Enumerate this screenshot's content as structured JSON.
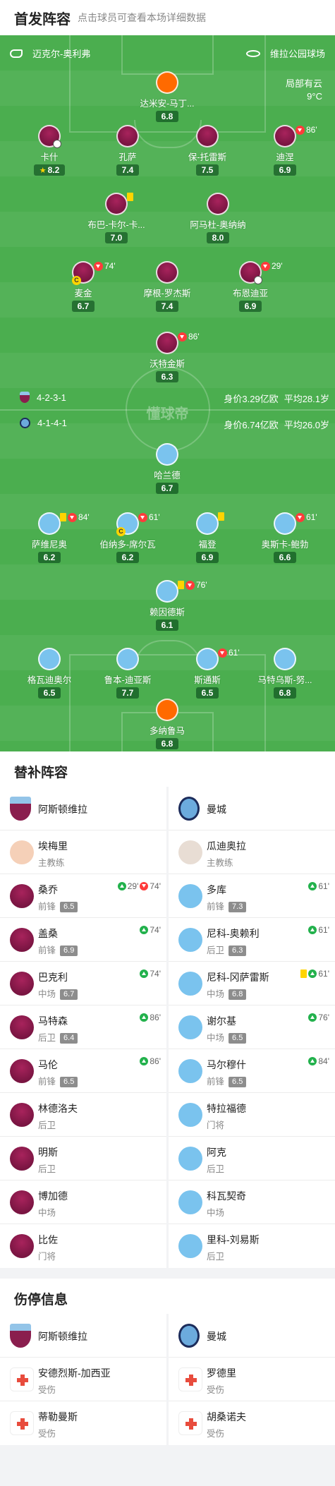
{
  "header": {
    "title": "首发阵容",
    "subtitle": "点击球员可查看本场详细数据"
  },
  "pitch": {
    "home_coach_label": "迈克尔-奥利弗",
    "venue": "维拉公园球场",
    "weather": "局部有云",
    "temp": "9°C",
    "watermark": "懂球帝",
    "home": {
      "formation": "4-2-3-1",
      "value": "身价3.29亿欧",
      "avg_age": "平均28.1岁"
    },
    "away": {
      "formation": "4-1-4-1",
      "value": "身价6.74亿欧",
      "avg_age": "平均26.0岁"
    }
  },
  "players": [
    {
      "name": "达米安-马丁...",
      "rating": "6.8"
    },
    {
      "name": "卡什",
      "rating": "8.2"
    },
    {
      "name": "孔萨",
      "rating": "7.4"
    },
    {
      "name": "保-托雷斯",
      "rating": "7.5"
    },
    {
      "name": "迪涅",
      "rating": "6.9",
      "ev": "86'"
    },
    {
      "name": "布巴-卡尔-卡...",
      "rating": "7.0"
    },
    {
      "name": "阿马杜-奥纳纳",
      "rating": "8.0"
    },
    {
      "name": "麦金",
      "rating": "6.7",
      "ev": "74'"
    },
    {
      "name": "摩根-罗杰斯",
      "rating": "7.4"
    },
    {
      "name": "布恩迪亚",
      "rating": "6.9",
      "ev": "29'"
    },
    {
      "name": "沃特金斯",
      "rating": "6.3",
      "ev": "86'"
    },
    {
      "name": "哈兰德",
      "rating": "6.7"
    },
    {
      "name": "萨维尼奥",
      "rating": "6.2",
      "ev": "84'"
    },
    {
      "name": "伯纳多-席尔瓦",
      "rating": "6.2",
      "ev": "61'"
    },
    {
      "name": "福登",
      "rating": "6.9"
    },
    {
      "name": "奥斯卡-鲍勃",
      "rating": "6.6",
      "ev": "61'"
    },
    {
      "name": "赖因德斯",
      "rating": "6.1",
      "ev": "76'"
    },
    {
      "name": "格瓦迪奥尔",
      "rating": "6.5"
    },
    {
      "name": "鲁本-迪亚斯",
      "rating": "7.7"
    },
    {
      "name": "斯通斯",
      "rating": "6.5",
      "ev": "61'"
    },
    {
      "name": "马特乌斯-努...",
      "rating": "6.8"
    },
    {
      "name": "多纳鲁马",
      "rating": "6.8"
    }
  ],
  "subs": {
    "title": "替补阵容",
    "home": {
      "team": "阿斯顿维拉",
      "coach": "埃梅里",
      "coach_role": "主教练",
      "list": [
        {
          "name": "桑乔",
          "pos": "前锋",
          "rating": "6.5",
          "in": "29'",
          "out": "74'"
        },
        {
          "name": "盖桑",
          "pos": "前锋",
          "rating": "6.9",
          "in": "74'"
        },
        {
          "name": "巴克利",
          "pos": "中场",
          "rating": "6.7",
          "in": "74'"
        },
        {
          "name": "马特森",
          "pos": "后卫",
          "rating": "6.4",
          "in": "86'"
        },
        {
          "name": "马伦",
          "pos": "前锋",
          "rating": "6.5",
          "in": "86'"
        },
        {
          "name": "林德洛夫",
          "pos": "后卫"
        },
        {
          "name": "明斯",
          "pos": "后卫"
        },
        {
          "name": "博加德",
          "pos": "中场"
        },
        {
          "name": "比佐",
          "pos": "门将"
        }
      ]
    },
    "away": {
      "team": "曼城",
      "coach": "瓜迪奥拉",
      "coach_role": "主教练",
      "list": [
        {
          "name": "多库",
          "pos": "前锋",
          "rating": "7.3",
          "in": "61'"
        },
        {
          "name": "尼科-奥赖利",
          "pos": "后卫",
          "rating": "6.3",
          "in": "61'"
        },
        {
          "name": "尼科-冈萨雷斯",
          "pos": "中场",
          "rating": "6.8",
          "in": "61'",
          "yc": true
        },
        {
          "name": "谢尔基",
          "pos": "中场",
          "rating": "6.5",
          "in": "76'"
        },
        {
          "name": "马尔穆什",
          "pos": "前锋",
          "rating": "6.5",
          "in": "84'"
        },
        {
          "name": "特拉福德",
          "pos": "门将"
        },
        {
          "name": "阿克",
          "pos": "后卫"
        },
        {
          "name": "科瓦契奇",
          "pos": "中场"
        },
        {
          "name": "里科-刘易斯",
          "pos": "后卫"
        }
      ]
    }
  },
  "injuries": {
    "title": "伤停信息",
    "home": {
      "team": "阿斯顿维拉",
      "list": [
        {
          "name": "安德烈斯-加西亚",
          "status": "受伤"
        },
        {
          "name": "蒂勒曼斯",
          "status": "受伤"
        }
      ]
    },
    "away": {
      "team": "曼城",
      "list": [
        {
          "name": "罗德里",
          "status": "受伤"
        },
        {
          "name": "胡桑诺夫",
          "status": "受伤"
        }
      ]
    }
  },
  "colors": {
    "pitch": "#4bae4f",
    "villa": "#7a1542",
    "city": "#7ac3ee",
    "gk": "#ff6a00"
  }
}
